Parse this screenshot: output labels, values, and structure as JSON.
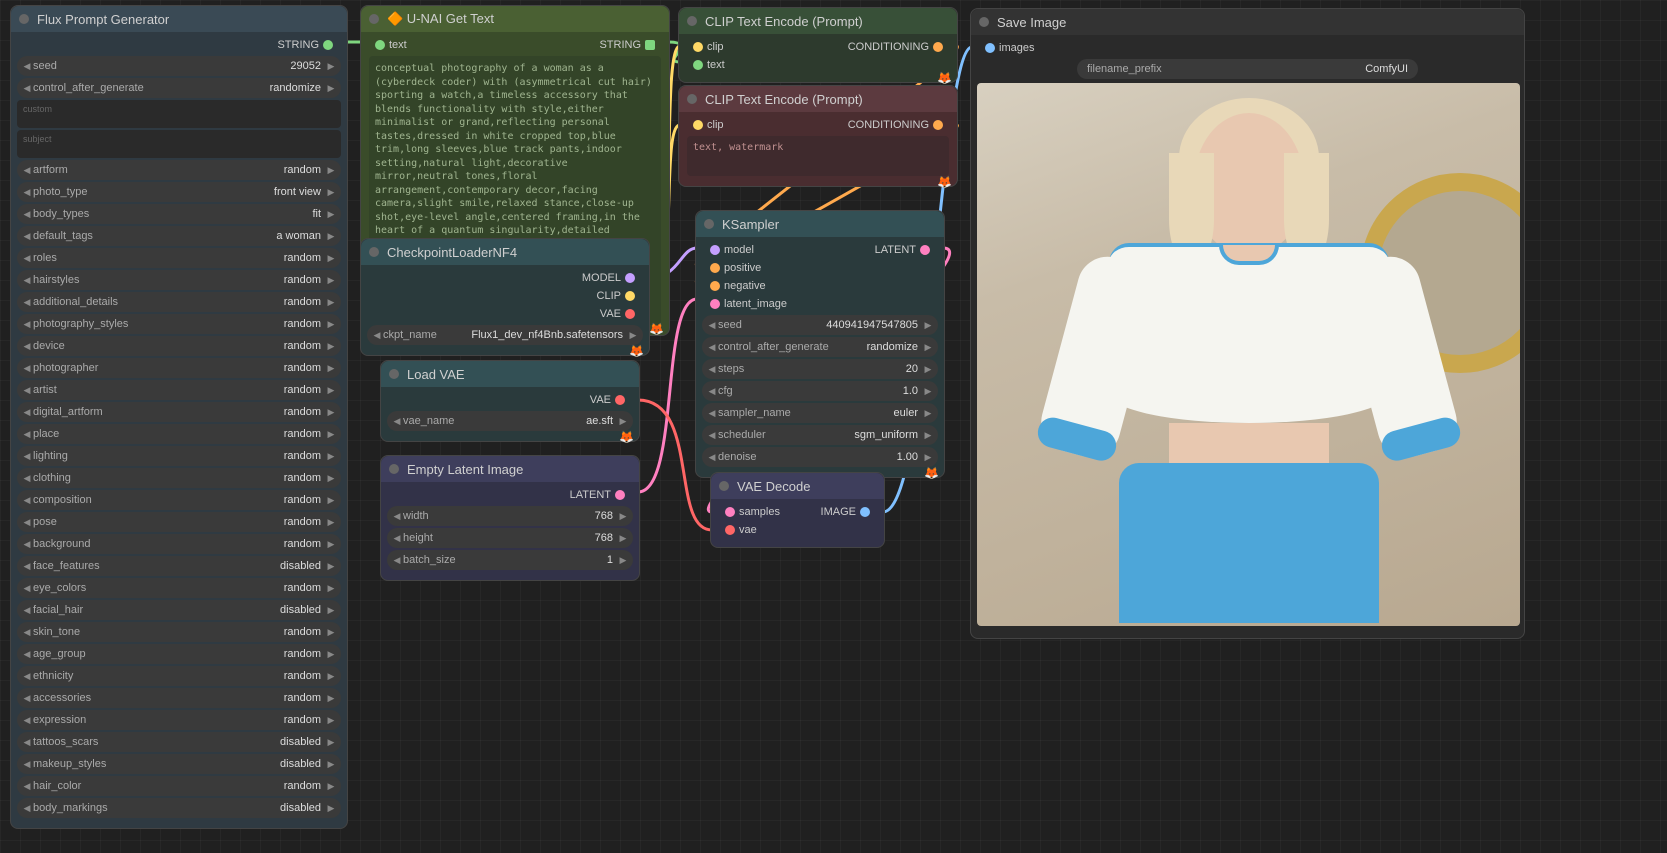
{
  "flux": {
    "title": "Flux Prompt Generator",
    "output_label": "STRING",
    "seed": {
      "label": "seed",
      "value": "29052"
    },
    "control_after_generate": {
      "label": "control_after_generate",
      "value": "randomize"
    },
    "custom_placeholder": "custom",
    "subject_placeholder": "subject",
    "params": [
      {
        "label": "artform",
        "value": "random"
      },
      {
        "label": "photo_type",
        "value": "front view"
      },
      {
        "label": "body_types",
        "value": "fit"
      },
      {
        "label": "default_tags",
        "value": "a woman"
      },
      {
        "label": "roles",
        "value": "random"
      },
      {
        "label": "hairstyles",
        "value": "random"
      },
      {
        "label": "additional_details",
        "value": "random"
      },
      {
        "label": "photography_styles",
        "value": "random"
      },
      {
        "label": "device",
        "value": "random"
      },
      {
        "label": "photographer",
        "value": "random"
      },
      {
        "label": "artist",
        "value": "random"
      },
      {
        "label": "digital_artform",
        "value": "random"
      },
      {
        "label": "place",
        "value": "random"
      },
      {
        "label": "lighting",
        "value": "random"
      },
      {
        "label": "clothing",
        "value": "random"
      },
      {
        "label": "composition",
        "value": "random"
      },
      {
        "label": "pose",
        "value": "random"
      },
      {
        "label": "background",
        "value": "random"
      },
      {
        "label": "face_features",
        "value": "disabled"
      },
      {
        "label": "eye_colors",
        "value": "random"
      },
      {
        "label": "facial_hair",
        "value": "disabled"
      },
      {
        "label": "skin_tone",
        "value": "random"
      },
      {
        "label": "age_group",
        "value": "random"
      },
      {
        "label": "ethnicity",
        "value": "random"
      },
      {
        "label": "accessories",
        "value": "random"
      },
      {
        "label": "expression",
        "value": "random"
      },
      {
        "label": "tattoos_scars",
        "value": "disabled"
      },
      {
        "label": "makeup_styles",
        "value": "disabled"
      },
      {
        "label": "hair_color",
        "value": "random"
      },
      {
        "label": "body_markings",
        "value": "disabled"
      }
    ]
  },
  "unai": {
    "title": "🔶 U-NAI Get Text",
    "input_label": "text",
    "output_label": "STRING",
    "text": "conceptual photography of a woman as a (cyberdeck coder) with (asymmetrical cut hair) sporting a watch,a timeless accessory that blends functionality with style,either minimalist or grand,reflecting personal tastes,dressed in white cropped top,blue trim,long sleeves,blue track pants,indoor setting,natural light,decorative mirror,neutral tones,floral arrangement,contemporary decor,facing camera,slight smile,relaxed stance,close-up shot,eye-level angle,centered framing,in the heart of a quantum singularity,detailed freckles skin,laser lighting heterochromia (grey and blue) weathered elderly Indigenous anklet furrowed brows highlights pencil-thin eyebrows,(front view:1.4),shot on DJI Mavic Air 2 with Built-in 24mm f-2.8,photo by Nick Brandt"
  },
  "clip1": {
    "title": "CLIP Text Encode (Prompt)",
    "clip_label": "clip",
    "text_label": "text",
    "output_label": "CONDITIONING"
  },
  "clip2": {
    "title": "CLIP Text Encode (Prompt)",
    "clip_label": "clip",
    "output_label": "CONDITIONING",
    "text": "text, watermark"
  },
  "ckpt": {
    "title": "CheckpointLoaderNF4",
    "model_label": "MODEL",
    "clip_label": "CLIP",
    "vae_label": "VAE",
    "ckpt_name_label": "ckpt_name",
    "ckpt_name_value": "Flux1_dev_nf4Bnb.safetensors"
  },
  "loadvae": {
    "title": "Load VAE",
    "vae_label": "VAE",
    "vae_name_label": "vae_name",
    "vae_name_value": "ae.sft"
  },
  "empty": {
    "title": "Empty Latent Image",
    "latent_label": "LATENT",
    "width": {
      "label": "width",
      "value": "768"
    },
    "height": {
      "label": "height",
      "value": "768"
    },
    "batch": {
      "label": "batch_size",
      "value": "1"
    }
  },
  "ksamp": {
    "title": "KSampler",
    "model_label": "model",
    "positive_label": "positive",
    "negative_label": "negative",
    "latent_label": "latent_image",
    "output_label": "LATENT",
    "seed": {
      "label": "seed",
      "value": "440941947547805"
    },
    "control": {
      "label": "control_after_generate",
      "value": "randomize"
    },
    "steps": {
      "label": "steps",
      "value": "20"
    },
    "cfg": {
      "label": "cfg",
      "value": "1.0"
    },
    "sampler": {
      "label": "sampler_name",
      "value": "euler"
    },
    "scheduler": {
      "label": "scheduler",
      "value": "sgm_uniform"
    },
    "denoise": {
      "label": "denoise",
      "value": "1.00"
    }
  },
  "vaedec": {
    "title": "VAE Decode",
    "samples_label": "samples",
    "vae_label": "vae",
    "image_label": "IMAGE"
  },
  "save": {
    "title": "Save Image",
    "images_label": "images",
    "prefix_label": "filename_prefix",
    "prefix_value": "ComfyUI"
  }
}
